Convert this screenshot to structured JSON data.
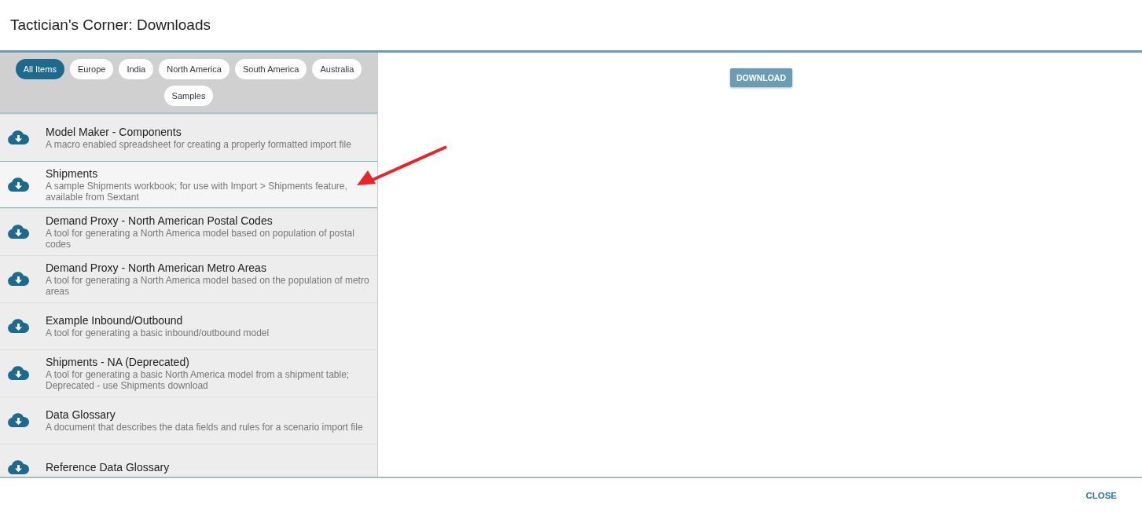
{
  "dialog": {
    "title": "Tactician's Corner: Downloads"
  },
  "filters": [
    {
      "label": "All Items",
      "selected": true
    },
    {
      "label": "Europe",
      "selected": false
    },
    {
      "label": "India",
      "selected": false
    },
    {
      "label": "North America",
      "selected": false
    },
    {
      "label": "South America",
      "selected": false
    },
    {
      "label": "Australia",
      "selected": false
    },
    {
      "label": "Samples",
      "selected": false
    }
  ],
  "items": [
    {
      "title": "Model Maker - Components",
      "description": "A macro enabled spreadsheet for creating a properly formatted import file",
      "selected": false
    },
    {
      "title": "Shipments",
      "description": "A sample Shipments workbook; for use with Import > Shipments feature, available from Sextant",
      "selected": true
    },
    {
      "title": "Demand Proxy - North American Postal Codes",
      "description": "A tool for generating a North America model based on population of postal codes",
      "selected": false
    },
    {
      "title": "Demand Proxy - North American Metro Areas",
      "description": "A tool for generating a North America model based on the population of metro areas",
      "selected": false
    },
    {
      "title": "Example Inbound/Outbound",
      "description": "A tool for generating a basic inbound/outbound model",
      "selected": false
    },
    {
      "title": "Shipments - NA (Deprecated)",
      "description": "A tool for generating a basic North America model from a shipment table; Deprecated - use Shipments download",
      "selected": false
    },
    {
      "title": "Data Glossary",
      "description": "A document that describes the data fields and rules for a scenario import file",
      "selected": false
    },
    {
      "title": "Reference Data Glossary",
      "selected": false
    }
  ],
  "download_button": "DOWNLOAD",
  "close_button": "CLOSE"
}
